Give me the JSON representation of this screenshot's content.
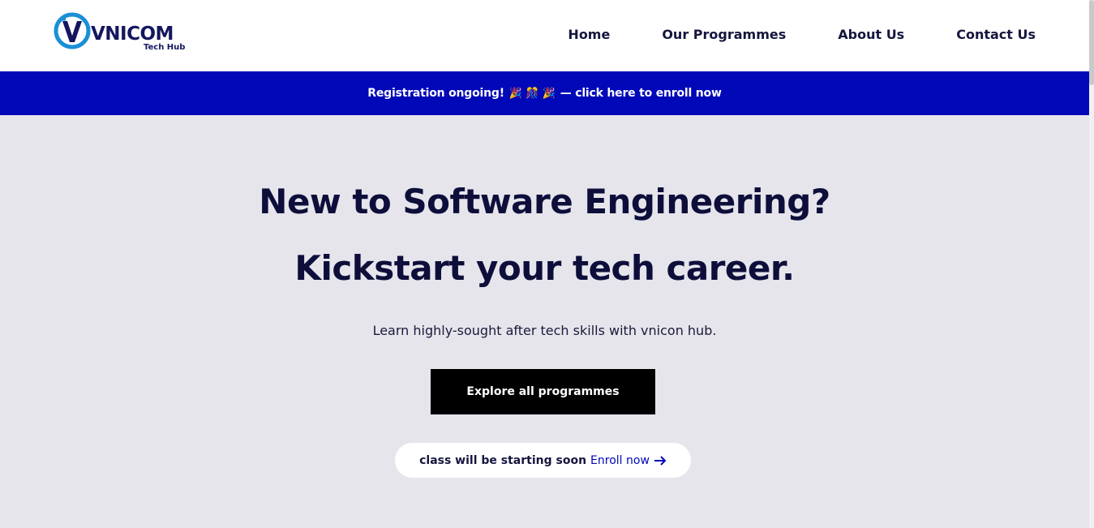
{
  "brand": {
    "name": "VNICOM",
    "tagline": "Tech Hub",
    "colors": {
      "primary": "#0008b8",
      "ring": "#1b8fd6",
      "text": "#14175e"
    }
  },
  "nav": {
    "items": [
      {
        "label": "Home"
      },
      {
        "label": "Our Programmes"
      },
      {
        "label": "About Us"
      },
      {
        "label": "Contact Us"
      }
    ]
  },
  "banner": {
    "text": "Registration ongoing!",
    "emojis": "🎉 🎊 🎉",
    "link_text": "— click here to enroll now",
    "background": "#0008b8"
  },
  "hero": {
    "title_line1": "New to Software Engineering?",
    "title_line2": "Kickstart your tech career.",
    "subtitle": "Learn highly-sought after tech skills with vnicon hub.",
    "cta_label": "Explore all programmes",
    "notice_text": "class will be starting soon",
    "notice_link": "Enroll now",
    "background": "#e6e5ec"
  }
}
